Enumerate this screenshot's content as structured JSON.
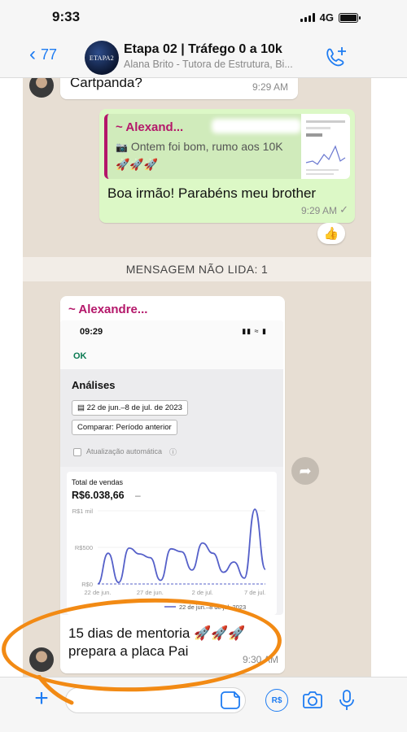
{
  "status_bar": {
    "time": "9:33",
    "network": "4G"
  },
  "header": {
    "back_count": "77",
    "avatar_text": "ETAPA2",
    "title": "Etapa 02 | Tráfego 0 a 10k",
    "subtitle": "Alana Brito - Tutora de Estrutura, Bi..."
  },
  "messages": {
    "top_in": {
      "text": "Cartpanda?",
      "time": "9:29 AM"
    },
    "out": {
      "quote_name": "~ Alexand...",
      "quote_text": "Ontem foi bom, rumo aos 10K",
      "quote_emoji": "🚀🚀🚀",
      "text": "Boa irmão! Parabéns meu brother",
      "time": "9:29 AM",
      "reaction": "👍"
    },
    "unread_banner": "MENSAGEM NÃO LIDA: 1",
    "image_msg": {
      "sender": "~ Alexandre...",
      "caption_line1": "15 dias de mentoria 🚀🚀🚀",
      "caption_line2": "prepara a placa Pai",
      "time": "9:30 AM"
    }
  },
  "screenshot": {
    "time": "09:29",
    "ok_label": "OK",
    "section_title": "Análises",
    "date_range": "22 de jun.–8 de jul. de 2023",
    "compare_label": "Comparar: Período anterior",
    "auto_update_label": "Atualização automática",
    "card_title": "Total de vendas",
    "total_value": "R$6.038,66",
    "total_suffix": "–",
    "legend": "22 de jun.–8 de jul. 2023"
  },
  "chart_data": {
    "type": "line",
    "title": "Total de vendas",
    "y_ticks": [
      "R$0",
      "R$500",
      "R$1 mil"
    ],
    "x_ticks": [
      "22 de jun.",
      "27 de jun.",
      "2 de jul.",
      "7 de jul."
    ],
    "ylim": [
      0,
      1000
    ],
    "series": [
      {
        "name": "22 de jun.–8 de jul. 2023",
        "x": [
          "22 de jun.",
          "23 de jun.",
          "24 de jun.",
          "25 de jun.",
          "26 de jun.",
          "27 de jun.",
          "28 de jun.",
          "29 de jun.",
          "30 de jun.",
          "1 de jul.",
          "2 de jul.",
          "3 de jul.",
          "4 de jul.",
          "5 de jul.",
          "6 de jul.",
          "7 de jul.",
          "8 de jul."
        ],
        "values": [
          0,
          420,
          20,
          490,
          410,
          360,
          50,
          480,
          440,
          190,
          560,
          420,
          160,
          300,
          80,
          1020,
          200
        ]
      }
    ],
    "colors": {
      "line": "#5560c9",
      "prior": "#8a9ad8"
    }
  },
  "input_bar": {
    "currency_label": "R$"
  }
}
